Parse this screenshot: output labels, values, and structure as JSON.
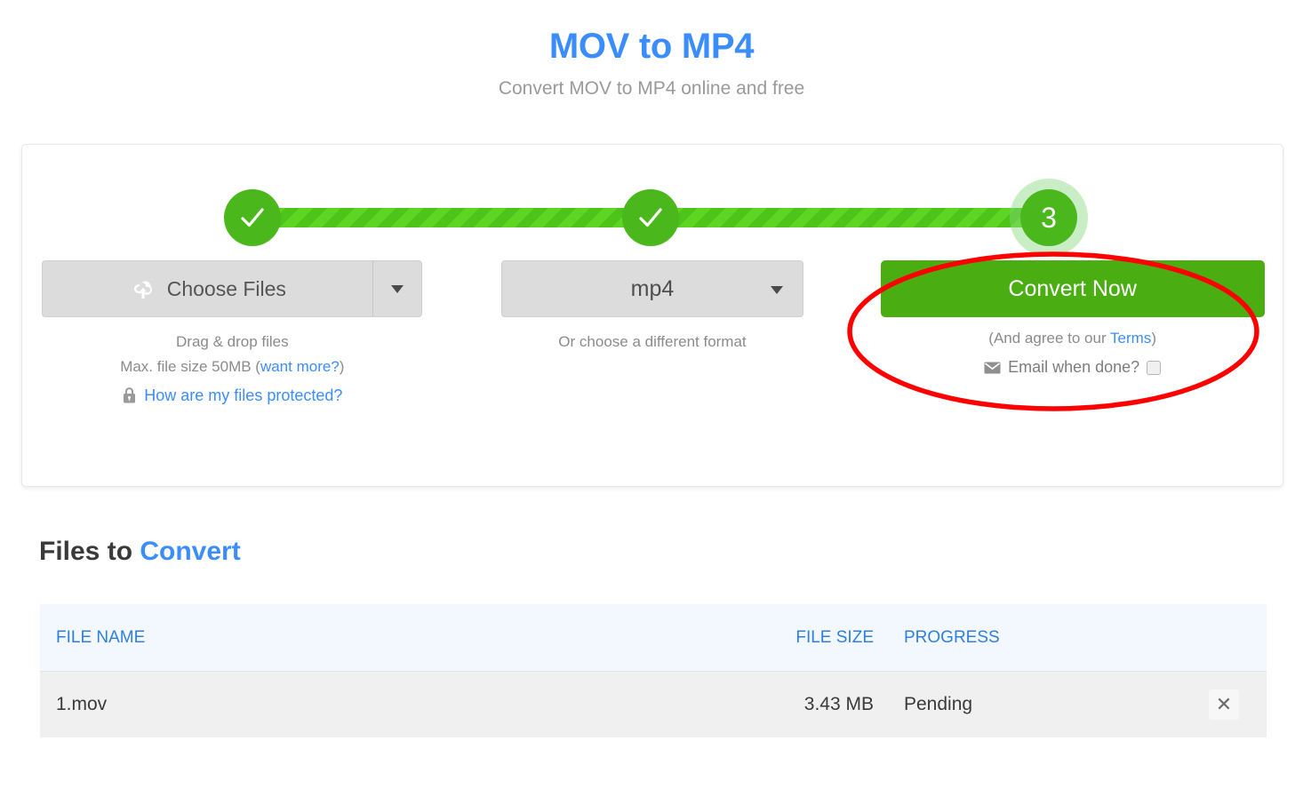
{
  "hero": {
    "title": "MOV to MP4",
    "subtitle": "Convert MOV to MP4 online and free"
  },
  "stepper": {
    "step1_state": "complete",
    "step2_state": "complete",
    "step3_label": "3"
  },
  "choose": {
    "button_label": "Choose Files",
    "icon": "cloud-upload-icon",
    "caret_icon": "chevron-down-icon",
    "drag_text": "Drag & drop files",
    "max_size_text": "Max. file size 50MB (",
    "want_more_label": "want more?",
    "max_size_tail": ")",
    "protected_label": "How are my files protected?",
    "lock_icon": "lock-icon"
  },
  "format": {
    "selected": "mp4",
    "caret_icon": "chevron-down-icon",
    "helper": "Or choose a different format"
  },
  "convert": {
    "button_label": "Convert Now",
    "terms_prefix": "(And agree to our ",
    "terms_link": "Terms",
    "terms_suffix": ")",
    "email_label": "Email when done?",
    "email_icon": "envelope-icon",
    "email_checked": false
  },
  "files_section": {
    "title_prefix": "Files to ",
    "title_accent": "Convert",
    "columns": {
      "name": "FILE NAME",
      "size": "FILE SIZE",
      "progress": "PROGRESS"
    },
    "rows": [
      {
        "name": "1.mov",
        "size": "3.43 MB",
        "progress": "Pending",
        "remove_icon": "close-icon",
        "remove_label": "✕"
      }
    ]
  },
  "annotation": {
    "shape": "red-ellipse-highlight",
    "color": "#FF0000",
    "target": "convert-now-button"
  },
  "colors": {
    "brand_blue": "#3c8dfc",
    "green": "#4aad12",
    "step_green": "#4ab81c",
    "grey_button": "#dcdcdc",
    "table_header_bg": "#f2f8fe"
  }
}
